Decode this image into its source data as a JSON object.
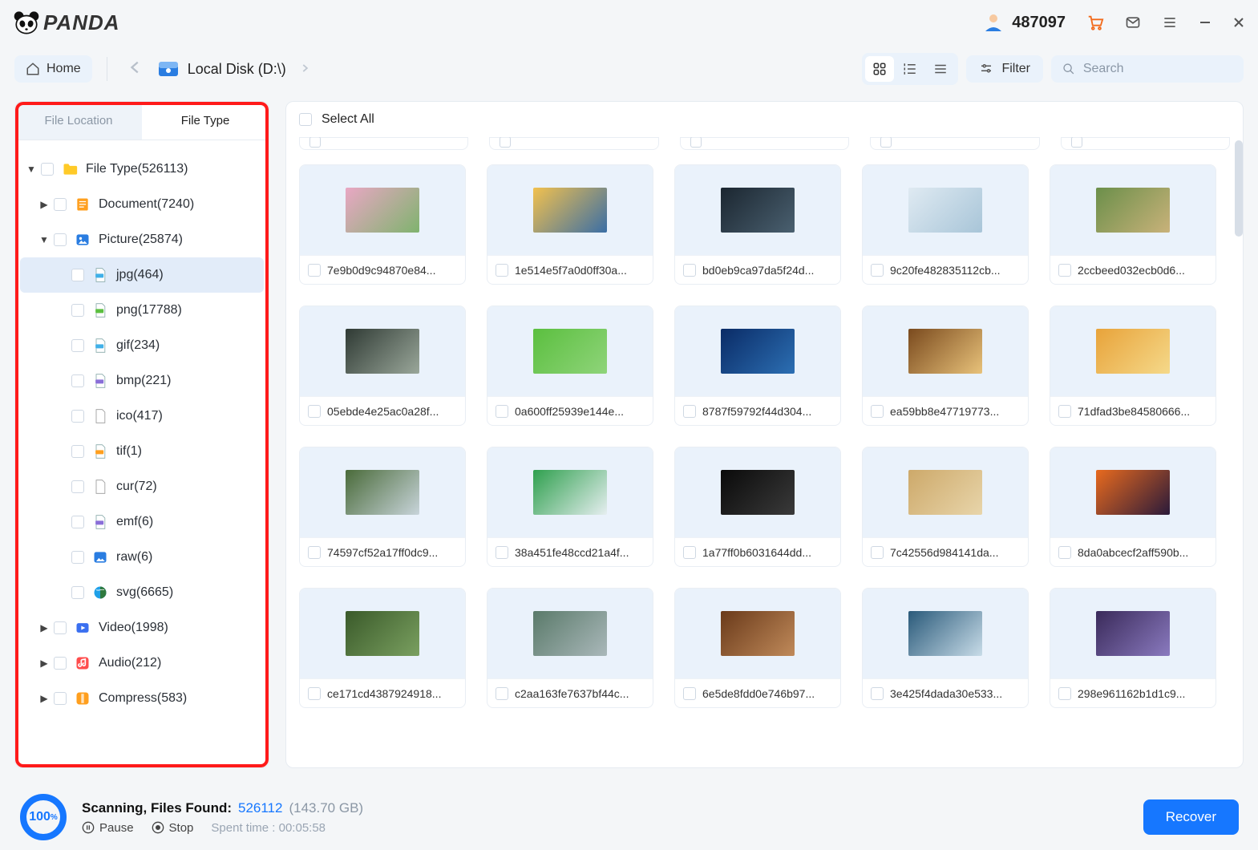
{
  "brand": "PANDA",
  "titlebar": {
    "user_id": "487097"
  },
  "toolbar": {
    "home_label": "Home",
    "path": "Local Disk (D:\\)",
    "filter_label": "Filter",
    "search_placeholder": "Search"
  },
  "sidebar": {
    "tabs": {
      "location": "File Location",
      "filetype": "File Type"
    },
    "tree": {
      "root": "File Type(526113)",
      "document": "Document(7240)",
      "picture": "Picture(25874)",
      "jpg": "jpg(464)",
      "png": "png(17788)",
      "gif": "gif(234)",
      "bmp": "bmp(221)",
      "ico": "ico(417)",
      "tif": "tif(1)",
      "cur": "cur(72)",
      "emf": "emf(6)",
      "raw": "raw(6)",
      "svg": "svg(6665)",
      "video": "Video(1998)",
      "audio": "Audio(212)",
      "compress": "Compress(583)"
    }
  },
  "main": {
    "select_all": "Select All",
    "files": [
      {
        "name": "7e9b0d9c94870e84...",
        "c1": "#e9a7c4",
        "c2": "#7fb36e"
      },
      {
        "name": "1e514e5f7a0d0ff30a...",
        "c1": "#f2c14e",
        "c2": "#3a6ea5"
      },
      {
        "name": "bd0eb9ca97da5f24d...",
        "c1": "#1b2630",
        "c2": "#4a6070"
      },
      {
        "name": "9c20fe482835112cb...",
        "c1": "#dfeaf2",
        "c2": "#a8c5d8"
      },
      {
        "name": "2ccbeed032ecb0d6...",
        "c1": "#6b8f4a",
        "c2": "#c9b27a"
      },
      {
        "name": "05ebde4e25ac0a28f...",
        "c1": "#2f3a34",
        "c2": "#9aa79a"
      },
      {
        "name": "0a600ff25939e144e...",
        "c1": "#5bbf3f",
        "c2": "#8fd47a"
      },
      {
        "name": "8787f59792f44d304...",
        "c1": "#0a2b66",
        "c2": "#2c6fb3"
      },
      {
        "name": "ea59bb8e47719773...",
        "c1": "#7a4a1e",
        "c2": "#e8c27a"
      },
      {
        "name": "71dfad3be84580666...",
        "c1": "#e8a33a",
        "c2": "#f5d98a"
      },
      {
        "name": "74597cf52a17ff0dc9...",
        "c1": "#4a6b3a",
        "c2": "#c8d4da"
      },
      {
        "name": "38a451fe48ccd21a4f...",
        "c1": "#2fa04e",
        "c2": "#e6eef0"
      },
      {
        "name": "1a77ff0b6031644dd...",
        "c1": "#0a0a0a",
        "c2": "#3a3a3a"
      },
      {
        "name": "7c42556d984141da...",
        "c1": "#cda96a",
        "c2": "#e8d5aa"
      },
      {
        "name": "8da0abcecf2aff590b...",
        "c1": "#e86a1e",
        "c2": "#2a1a3a"
      },
      {
        "name": "ce171cd4387924918...",
        "c1": "#3a5a2a",
        "c2": "#7aa060"
      },
      {
        "name": "c2aa163fe7637bf44c...",
        "c1": "#5a7a6a",
        "c2": "#aab8ba"
      },
      {
        "name": "6e5de8fdd0e746b97...",
        "c1": "#6a3a1a",
        "c2": "#c08a5a"
      },
      {
        "name": "3e425f4dada30e533...",
        "c1": "#2a5a7a",
        "c2": "#c8dce8"
      },
      {
        "name": "298e961162b1d1c9...",
        "c1": "#3a2a5a",
        "c2": "#8a7abf"
      }
    ]
  },
  "status": {
    "percent_label": "100",
    "percent_suffix": "%",
    "scanning_label": "Scanning, Files Found:",
    "count": "526112",
    "size": "(143.70 GB)",
    "pause": "Pause",
    "stop": "Stop",
    "spent_label": "Spent time :",
    "spent_value": "00:05:58",
    "recover": "Recover"
  }
}
